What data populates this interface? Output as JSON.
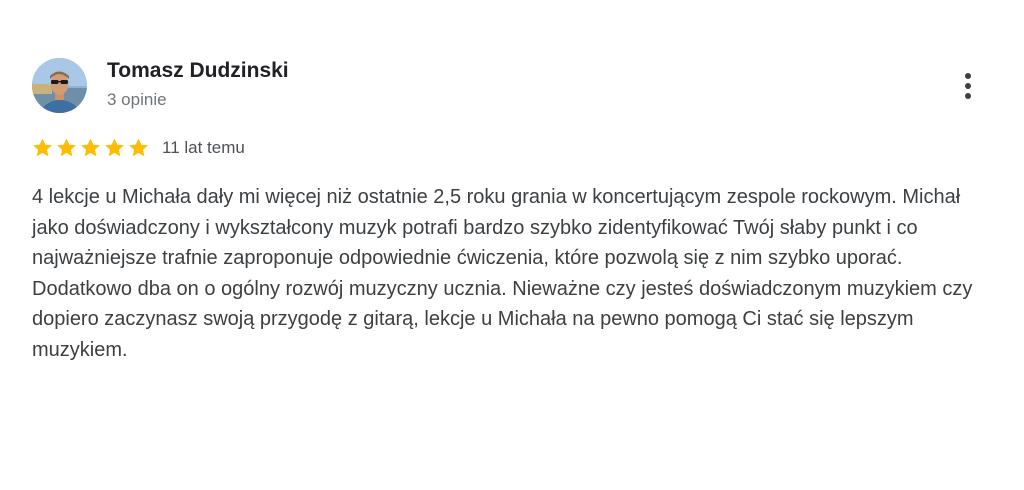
{
  "review": {
    "reviewer_name": "Tomasz Dudzinski",
    "review_count": "3 opinie",
    "rating": 5,
    "rating_max": 5,
    "date": "11 lat temu",
    "text": "4 lekcje u Michała dały mi więcej niż ostatnie 2,5 roku grania w koncertującym zespole rockowym. Michał jako doświadczony i wykształcony muzyk potrafi bardzo szybko zidentyfikować Twój słaby punkt i co najważniejsze trafnie zaproponuje odpowiednie ćwiczenia, które pozwolą się z nim szybko uporać. Dodatkowo dba on o ogólny rozwój muzyczny ucznia. Nieważne czy jesteś doświadczonym muzykiem czy dopiero zaczynasz swoją przygodę z gitarą, lekcje u Michała na pewno pomogą Ci stać się lepszym muzykiem."
  },
  "icons": {
    "avatar": "user-photo",
    "star": "star-icon",
    "more": "more-vert-icon"
  },
  "colors": {
    "star": "#fbbc04",
    "name": "#202124",
    "secondary_text": "#70757a",
    "body_text": "#3c4043"
  }
}
